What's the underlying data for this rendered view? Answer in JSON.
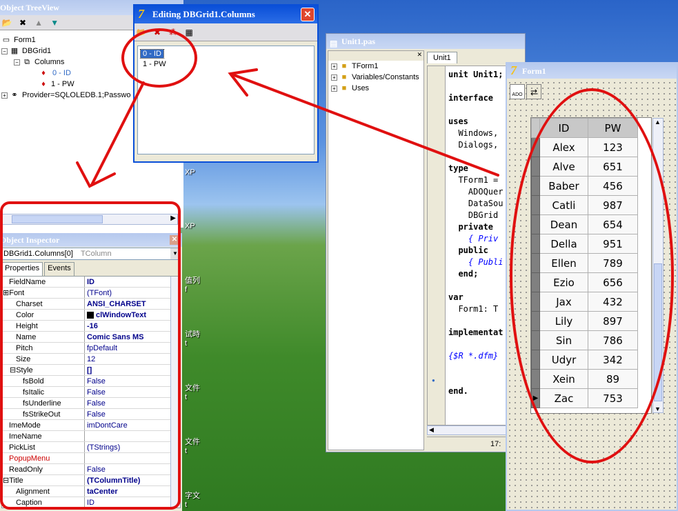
{
  "tree_view": {
    "title": "Object TreeView",
    "items": [
      {
        "label": "Form1"
      },
      {
        "label": "DBGrid1"
      },
      {
        "label": "Columns"
      },
      {
        "label": "0 - ID"
      },
      {
        "label": "1 - PW"
      },
      {
        "label": "Provider=SQLOLEDB.1;Passwo"
      }
    ]
  },
  "columns_editor": {
    "title": "Editing DBGrid1.Columns",
    "items": [
      "0 - ID",
      "1 - PW"
    ]
  },
  "inspector": {
    "title": "Object Inspector",
    "selector": "DBGrid1.Columns[0]",
    "selector_type": "TColumn",
    "tabs": [
      "Properties",
      "Events"
    ],
    "rows": [
      {
        "name": "FieldName",
        "value": "ID",
        "bold": true
      },
      {
        "name": "Font",
        "value": "(TFont)",
        "expand": "+"
      },
      {
        "name": "Charset",
        "value": "ANSI_CHARSET",
        "bold": true,
        "indent": 1
      },
      {
        "name": "Color",
        "value": "clWindowText",
        "bold": true,
        "indent": 1,
        "swatch": true
      },
      {
        "name": "Height",
        "value": "-16",
        "bold": true,
        "indent": 1
      },
      {
        "name": "Name",
        "value": "Comic Sans MS",
        "bold": true,
        "indent": 1
      },
      {
        "name": "Pitch",
        "value": "fpDefault",
        "indent": 1
      },
      {
        "name": "Size",
        "value": "12",
        "indent": 1
      },
      {
        "name": "Style",
        "value": "[]",
        "bold": true,
        "indent": 1,
        "expand": "-"
      },
      {
        "name": "fsBold",
        "value": "False",
        "indent": 2
      },
      {
        "name": "fsItalic",
        "value": "False",
        "indent": 2
      },
      {
        "name": "fsUnderline",
        "value": "False",
        "indent": 2
      },
      {
        "name": "fsStrikeOut",
        "value": "False",
        "indent": 2
      },
      {
        "name": "ImeMode",
        "value": "imDontCare"
      },
      {
        "name": "ImeName",
        "value": ""
      },
      {
        "name": "PickList",
        "value": "(TStrings)"
      },
      {
        "name": "PopupMenu",
        "value": "",
        "red": true
      },
      {
        "name": "ReadOnly",
        "value": "False"
      },
      {
        "name": "Title",
        "value": "(TColumnTitle)",
        "bold": true,
        "expand": "-"
      },
      {
        "name": "Alignment",
        "value": "taCenter",
        "bold": true,
        "indent": 1
      },
      {
        "name": "Caption",
        "value": "ID",
        "indent": 1
      }
    ]
  },
  "unit_window": {
    "title": "Unit1.pas",
    "tab": "Unit1",
    "tree": [
      "TForm1",
      "Variables/Constants",
      "Uses"
    ],
    "status_pos": "17:",
    "code_lines": [
      {
        "t": "unit Unit1;",
        "kw": true
      },
      {
        "t": ""
      },
      {
        "t": "interface",
        "kw": true
      },
      {
        "t": ""
      },
      {
        "t": "uses",
        "kw": true
      },
      {
        "t": "  Windows,"
      },
      {
        "t": "  Dialogs,"
      },
      {
        "t": ""
      },
      {
        "t": "type",
        "kw": true
      },
      {
        "t": "  TForm1 = "
      },
      {
        "t": "    ADOQuer"
      },
      {
        "t": "    DataSou"
      },
      {
        "t": "    DBGrid"
      },
      {
        "t": "  private",
        "kw": true
      },
      {
        "t": "    { Priv",
        "cm": true
      },
      {
        "t": "  public",
        "kw": true
      },
      {
        "t": "    { Publi",
        "cm": true
      },
      {
        "t": "  end;",
        "kw": true
      },
      {
        "t": ""
      },
      {
        "t": "var",
        "kw": true
      },
      {
        "t": "  Form1: T"
      },
      {
        "t": ""
      },
      {
        "t": "implementat",
        "kw": true
      },
      {
        "t": ""
      },
      {
        "t": "{$R *.dfm}",
        "cm": true
      },
      {
        "t": ""
      },
      {
        "t": ""
      },
      {
        "t": "end.",
        "kw": true
      }
    ]
  },
  "form_window": {
    "title": "Form1",
    "ado_label": "ADO",
    "grid": {
      "headers": [
        "ID",
        "PW"
      ],
      "rows": [
        [
          "Alex",
          "123"
        ],
        [
          "Alve",
          "651"
        ],
        [
          "Baber",
          "456"
        ],
        [
          "Catli",
          "987"
        ],
        [
          "Dean",
          "654"
        ],
        [
          "Della",
          "951"
        ],
        [
          "Ellen",
          "789"
        ],
        [
          "Ezio",
          "656"
        ],
        [
          "Jax",
          "432"
        ],
        [
          "Lily",
          "897"
        ],
        [
          "Sin",
          "786"
        ],
        [
          "Udyr",
          "342"
        ],
        [
          "Xein",
          "89"
        ],
        [
          "Zac",
          "753"
        ]
      ]
    }
  },
  "desktop_labels": [
    "XP",
    "XP",
    "值列",
    "f",
    "试時",
    "t",
    "文件",
    "t",
    "文件",
    "t",
    "字文",
    "t"
  ],
  "colors": {
    "annotation": "#e01010",
    "title_active": "#0a4fd8",
    "selection": "#316ac5"
  }
}
